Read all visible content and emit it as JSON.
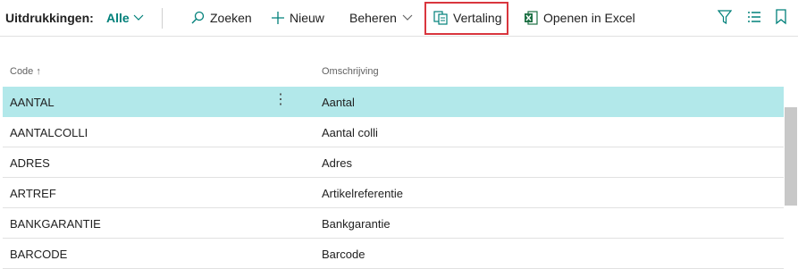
{
  "toolbar": {
    "title": "Uitdrukkingen:",
    "view_label": "Alle",
    "search_label": "Zoeken",
    "new_label": "Nieuw",
    "manage_label": "Beheren",
    "translate_label": "Vertaling",
    "excel_label": "Openen in Excel",
    "icons": [
      "chevron-down-icon",
      "search-icon",
      "plus-icon",
      "chevron-down-icon",
      "translate-icon",
      "excel-icon",
      "filter-icon",
      "list-icon",
      "bookmark-icon"
    ],
    "accent_color": "#00807a",
    "highlight_color": "#d9363e"
  },
  "table": {
    "columns": {
      "code": "Code",
      "code_sort": "↑",
      "description": "Omschrijving"
    },
    "rows": [
      {
        "code": "AANTAL",
        "description": "Aantal",
        "selected": true
      },
      {
        "code": "AANTALCOLLI",
        "description": "Aantal colli",
        "selected": false
      },
      {
        "code": "ADRES",
        "description": "Adres",
        "selected": false
      },
      {
        "code": "ARTREF",
        "description": "Artikelreferentie",
        "selected": false
      },
      {
        "code": "BANKGARANTIE",
        "description": "Bankgarantie",
        "selected": false
      },
      {
        "code": "BARCODE",
        "description": "Barcode",
        "selected": false
      }
    ],
    "row_actions_glyph": "⋮"
  }
}
